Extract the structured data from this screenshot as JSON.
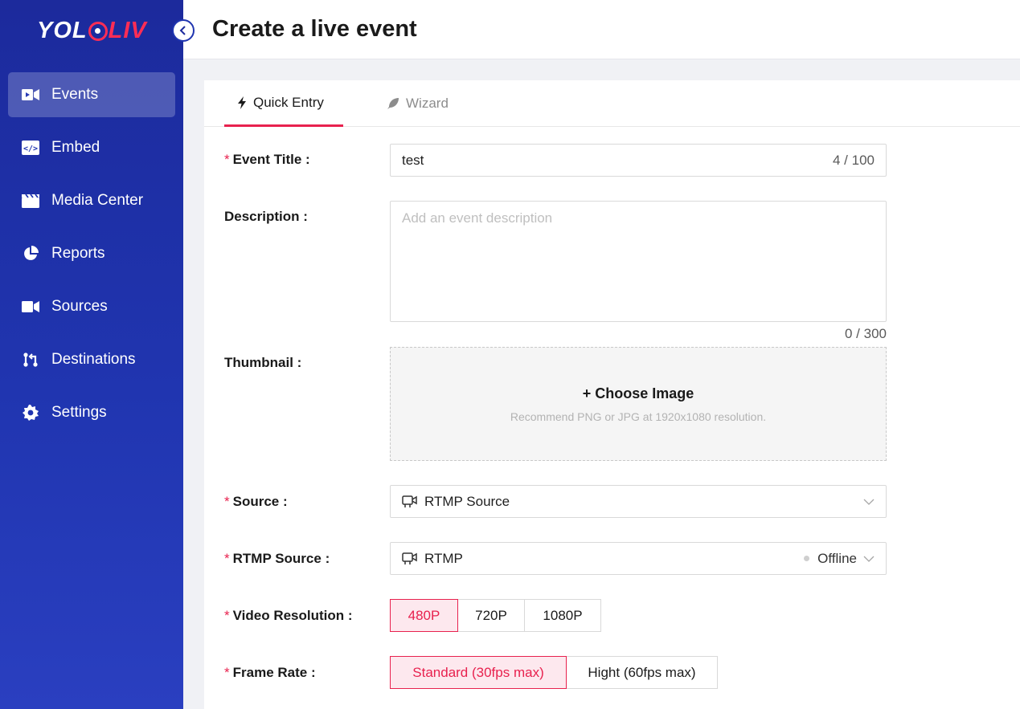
{
  "logo": {
    "part1": "YOL",
    "part2": "LIV"
  },
  "sidebar": {
    "items": [
      {
        "label": "Events",
        "icon": "video-camera-icon",
        "active": true
      },
      {
        "label": "Embed",
        "icon": "code-icon",
        "active": false
      },
      {
        "label": "Media Center",
        "icon": "clapperboard-icon",
        "active": false
      },
      {
        "label": "Reports",
        "icon": "pie-chart-icon",
        "active": false
      },
      {
        "label": "Sources",
        "icon": "camera-icon",
        "active": false
      },
      {
        "label": "Destinations",
        "icon": "branch-icon",
        "active": false
      },
      {
        "label": "Settings",
        "icon": "gear-icon",
        "active": false
      }
    ]
  },
  "header": {
    "title": "Create a live event"
  },
  "tabs": [
    {
      "label": "Quick Entry",
      "icon": "bolt-icon",
      "active": true
    },
    {
      "label": "Wizard",
      "icon": "feather-icon",
      "active": false
    }
  ],
  "form": {
    "required_mark": "*",
    "event_title": {
      "label": "Event Title",
      "value": "test",
      "count": "4 / 100"
    },
    "description": {
      "label": "Description",
      "placeholder": "Add an event description",
      "count": "0 / 300"
    },
    "thumbnail": {
      "label": "Thumbnail",
      "choose": "+ Choose Image",
      "recommend": "Recommend PNG or JPG at 1920x1080 resolution."
    },
    "source": {
      "label": "Source",
      "value": "RTMP Source"
    },
    "rtmp_source": {
      "label": "RTMP Source",
      "value": "RTMP",
      "status": "Offline"
    },
    "video_resolution": {
      "label": "Video Resolution",
      "options": [
        "480P",
        "720P",
        "1080P"
      ],
      "selected": "480P"
    },
    "frame_rate": {
      "label": "Frame Rate",
      "options": [
        "Standard (30fps max)",
        "Hight (60fps max)"
      ],
      "selected": "Standard (30fps max)"
    }
  },
  "colors": {
    "accent": "#e8214e",
    "sidebar": "#2035b0"
  }
}
